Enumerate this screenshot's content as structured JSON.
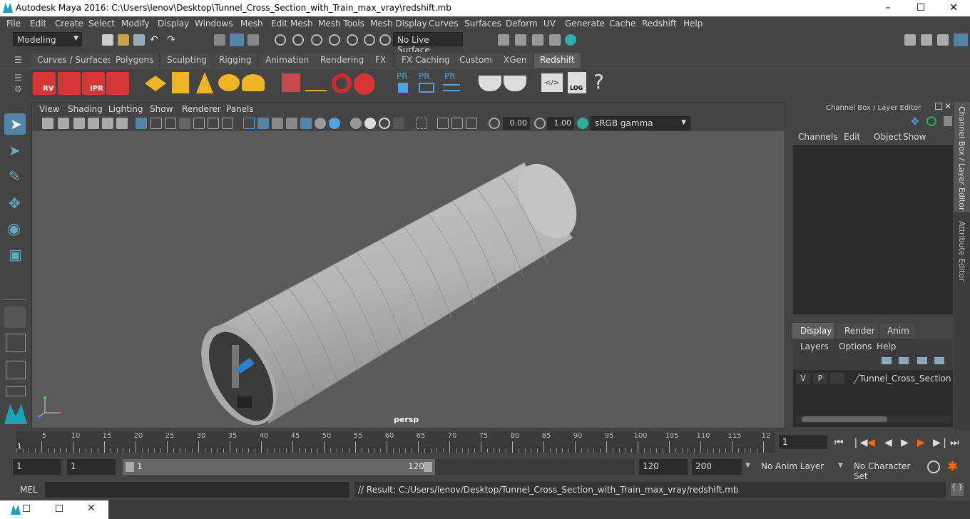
{
  "window": {
    "title": "Autodesk Maya 2016: C:\\Users\\lenov\\Desktop\\Tunnel_Cross_Section_with_Train_max_vray\\redshift.mb"
  },
  "menubar": [
    "File",
    "Edit",
    "Create",
    "Select",
    "Modify",
    "Display",
    "Windows",
    "Mesh",
    "Edit Mesh",
    "Mesh Tools",
    "Mesh Display",
    "Curves",
    "Surfaces",
    "Deform",
    "UV",
    "Generate",
    "Cache",
    "Redshift",
    "Help"
  ],
  "status": {
    "mode": "Modeling",
    "live_surface": "No Live Surface"
  },
  "shelf_tabs": [
    "Curves / Surfaces",
    "Polygons",
    "Sculpting",
    "Rigging",
    "Animation",
    "Rendering",
    "FX",
    "FX Caching",
    "Custom",
    "XGen",
    "Redshift"
  ],
  "shelf_active": "Redshift",
  "shelf_icons": {
    "rv": "RV",
    "ipr": "IPR",
    "pr1": "PR",
    "pr2": "PR",
    "pr3": "PR",
    "log": "LOG",
    "help": "?"
  },
  "viewport": {
    "menu": [
      "View",
      "Shading",
      "Lighting",
      "Show",
      "Renderer",
      "Panels"
    ],
    "exposure": "0.00",
    "gamma": "1.00",
    "colorspace": "sRGB gamma",
    "camera_label": "persp"
  },
  "channelbox": {
    "title": "Channel Box / Layer Editor",
    "menu": [
      "Channels",
      "Edit",
      "Object",
      "Show"
    ],
    "layer_tabs": [
      "Display",
      "Render",
      "Anim"
    ],
    "layer_tabs_active": "Display",
    "layer_menu": [
      "Layers",
      "Options",
      "Help"
    ],
    "layer": {
      "v": "V",
      "p": "P",
      "name": "Tunnel_Cross_Section_w"
    }
  },
  "side_tabs": [
    "Channel Box / Layer Editor",
    "Attribute Editor"
  ],
  "timeline": {
    "ticks": [
      "5",
      "10",
      "15",
      "20",
      "25",
      "30",
      "35",
      "40",
      "45",
      "50",
      "55",
      "60",
      "65",
      "70",
      "75",
      "80",
      "85",
      "90",
      "95",
      "100",
      "105",
      "110",
      "115",
      "12"
    ],
    "start_label": "1",
    "current_frame": "1"
  },
  "range": {
    "start": "1",
    "playback_start": "1",
    "slider_start": "1",
    "slider_end": "120",
    "playback_end": "120",
    "end": "200",
    "anim_layer": "No Anim Layer",
    "char_set": "No Character Set"
  },
  "cmdline": {
    "label": "MEL",
    "result": "// Result: C:/Users/lenov/Desktop/Tunnel_Cross_Section_with_Train_max_vray/redshift.mb"
  },
  "colors": {
    "accent": "#5d5d5d",
    "redshift_red": "#d43535",
    "highlight_blue": "#5285a6"
  }
}
